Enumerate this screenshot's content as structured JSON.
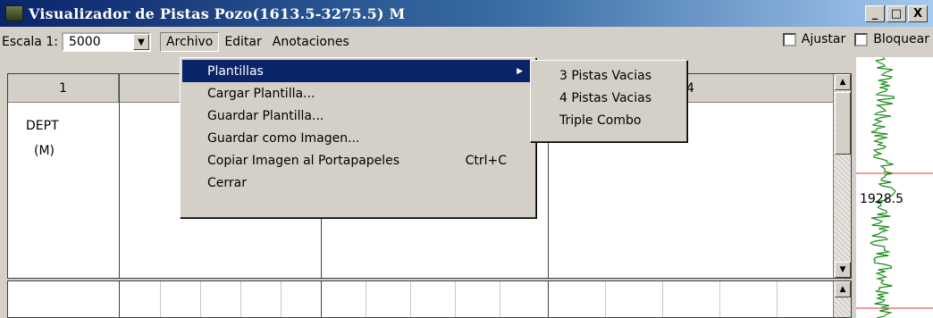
{
  "window": {
    "title": "Visualizador de Pistas Pozo(1613.5-3275.5) M",
    "controls": [
      "_",
      "□",
      "X"
    ]
  },
  "toolbar": {
    "scale_label": "Escala 1:",
    "scale_value": "5000",
    "menus": [
      "Archivo",
      "Editar",
      "Anotaciones"
    ],
    "ajustar_label": "Ajustar",
    "bloquear_label": "Bloquear"
  },
  "tracks": {
    "headers": [
      "1",
      "",
      "",
      "4"
    ],
    "dept_label": "DEPT",
    "unit_label": "(M)"
  },
  "log": {
    "depth_marker": "1928.5",
    "curve_color": "#1a8a1a",
    "line_color": "#d23c3c"
  },
  "archivo_menu": {
    "items": [
      {
        "label": "Plantillas",
        "shortcut": "",
        "submenu": true
      },
      {
        "label": "Cargar Plantilla...",
        "shortcut": ""
      },
      {
        "label": "Guardar Plantilla...",
        "shortcut": ""
      },
      {
        "label": "Guardar como Imagen...",
        "shortcut": ""
      },
      {
        "label": "Copiar Imagen al Portapapeles",
        "shortcut": "Ctrl+C"
      },
      {
        "label": "Cerrar",
        "shortcut": ""
      }
    ]
  },
  "plantillas_submenu": {
    "items": [
      "3 Pistas Vacias",
      "4 Pistas Vacias",
      "Triple Combo"
    ]
  }
}
